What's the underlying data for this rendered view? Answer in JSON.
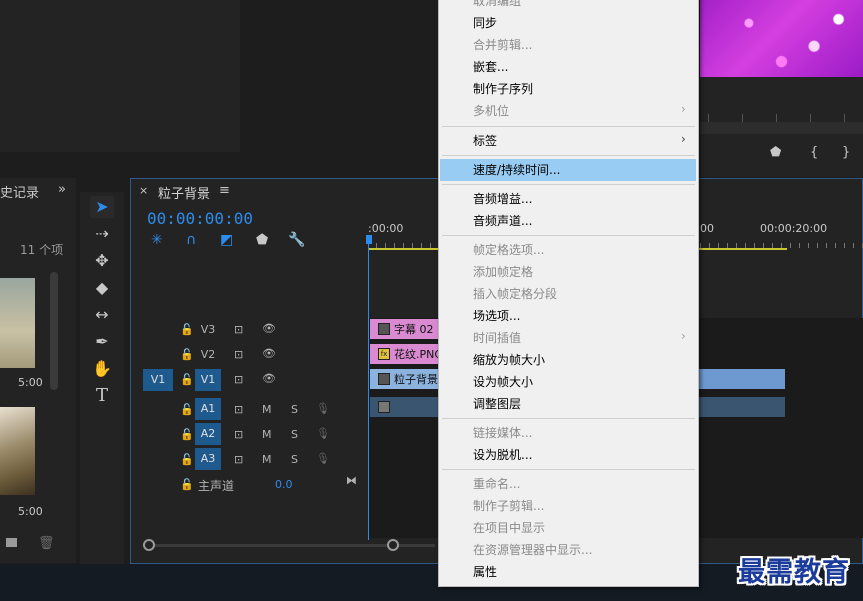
{
  "colors": {
    "accent": "#2d8ceb",
    "menu_bg": "#f0f0f0",
    "menu_highlight": "#99ccf3",
    "clip_pink": "#d98ad0",
    "clip_blue": "#8cb2de"
  },
  "project": {
    "tab_label": "史记录",
    "more": "»",
    "item_count": "11 个项",
    "thumb1_time": "5:00",
    "thumb2_time": "5:00"
  },
  "timeline": {
    "close": "×",
    "title": "粒子背景",
    "menu": "≡",
    "timecode": "00:00:00:00",
    "ruler": {
      "start": ":00:00",
      "mid": "00",
      "end": "00:00:20:00"
    },
    "tracks": {
      "v3": "V3",
      "v2": "V2",
      "v1": "V1",
      "v1_src": "V1",
      "a1": "A1",
      "a2": "A2",
      "a3": "A3",
      "mute": "M",
      "solo": "S",
      "master_label": "主声道",
      "master_value": "0.0"
    },
    "clips": {
      "v3": "字幕 02",
      "v2": "花纹.PNG",
      "v1": "粒子背景",
      "fx": "fx"
    }
  },
  "context_menu": {
    "items": [
      {
        "label": "取消编组",
        "enabled": false
      },
      {
        "label": "同步",
        "enabled": true
      },
      {
        "label": "合并剪辑...",
        "enabled": false
      },
      {
        "label": "嵌套...",
        "enabled": true
      },
      {
        "label": "制作子序列",
        "enabled": true
      },
      {
        "label": "多机位",
        "enabled": false,
        "submenu": true
      },
      {
        "label": "标签",
        "enabled": true,
        "submenu": true
      },
      {
        "label": "速度/持续时间...",
        "enabled": true,
        "highlighted": true
      },
      {
        "label": "音频增益...",
        "enabled": true
      },
      {
        "label": "音频声道...",
        "enabled": true
      },
      {
        "label": "帧定格选项...",
        "enabled": false
      },
      {
        "label": "添加帧定格",
        "enabled": false
      },
      {
        "label": "插入帧定格分段",
        "enabled": false
      },
      {
        "label": "场选项...",
        "enabled": true
      },
      {
        "label": "时间插值",
        "enabled": false,
        "submenu": true
      },
      {
        "label": "缩放为帧大小",
        "enabled": true
      },
      {
        "label": "设为帧大小",
        "enabled": true
      },
      {
        "label": "调整图层",
        "enabled": true
      },
      {
        "label": "链接媒体...",
        "enabled": false
      },
      {
        "label": "设为脱机...",
        "enabled": true
      },
      {
        "label": "重命名...",
        "enabled": false
      },
      {
        "label": "制作子剪辑...",
        "enabled": false
      },
      {
        "label": "在项目中显示",
        "enabled": false
      },
      {
        "label": "在资源管理器中显示...",
        "enabled": false
      },
      {
        "label": "属性",
        "enabled": true
      }
    ],
    "arrow": "›"
  },
  "watermark": "最需教育",
  "icons": {
    "select": "selection-tool-icon",
    "track_select": "track-select-icon",
    "ripple": "ripple-edit-icon",
    "razor": "razor-icon",
    "slip": "slip-icon",
    "pen": "pen-icon",
    "hand": "hand-icon",
    "type": "type-icon"
  }
}
